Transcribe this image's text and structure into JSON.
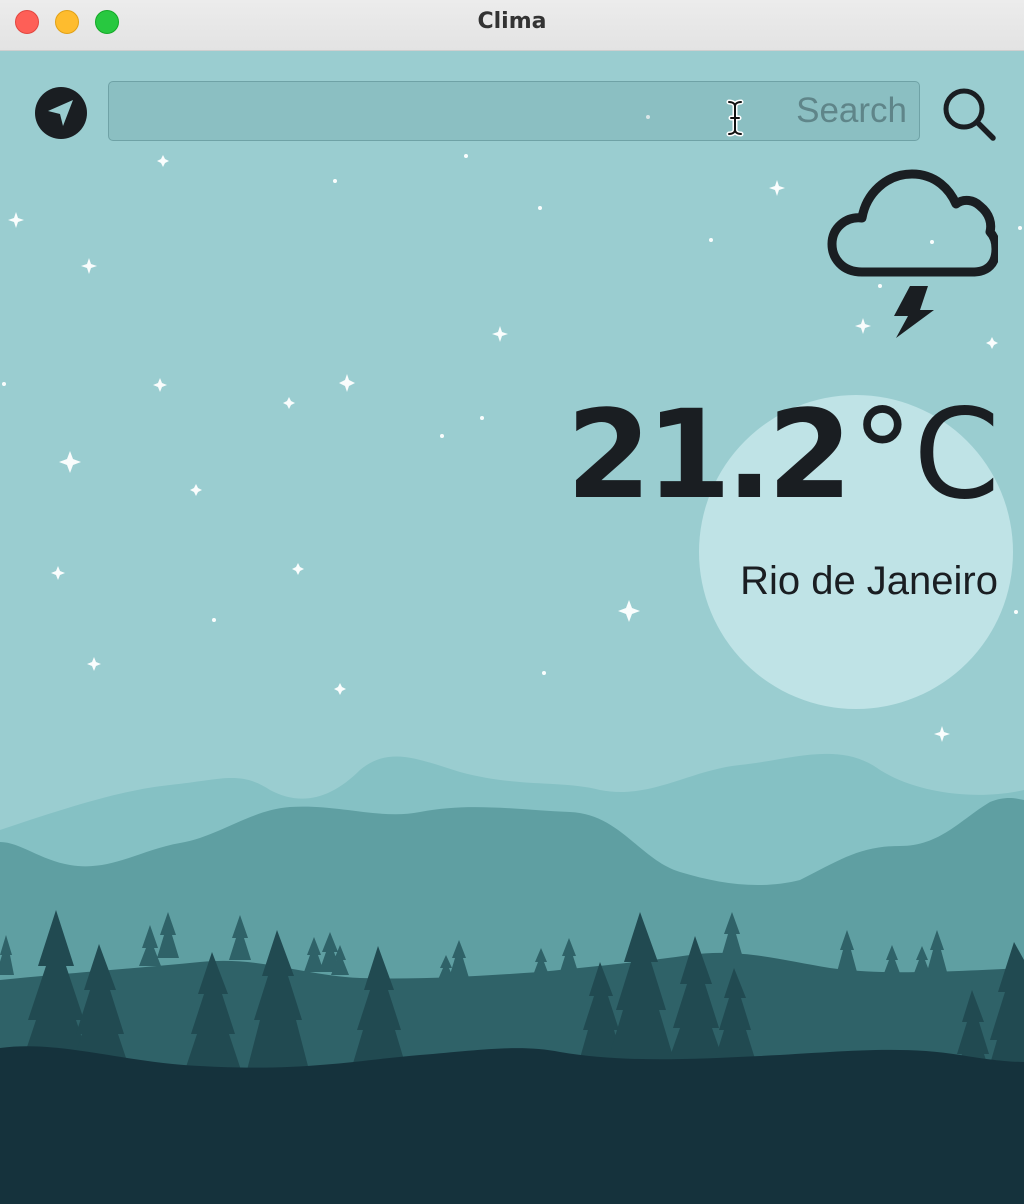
{
  "window": {
    "title": "Clima"
  },
  "search": {
    "placeholder": "Search",
    "value": ""
  },
  "weather": {
    "condition_icon": "cloud-bolt-icon",
    "temperature": "21.2",
    "unit": "°C",
    "city": "Rio de Janeiro"
  },
  "icons": {
    "location": "location-arrow-icon",
    "search": "magnifying-glass-icon"
  },
  "colors": {
    "sky": "#9acdd0",
    "moon": "#bfe3e6",
    "foreground_dark": "#15323c",
    "text": "#1a1e22"
  }
}
